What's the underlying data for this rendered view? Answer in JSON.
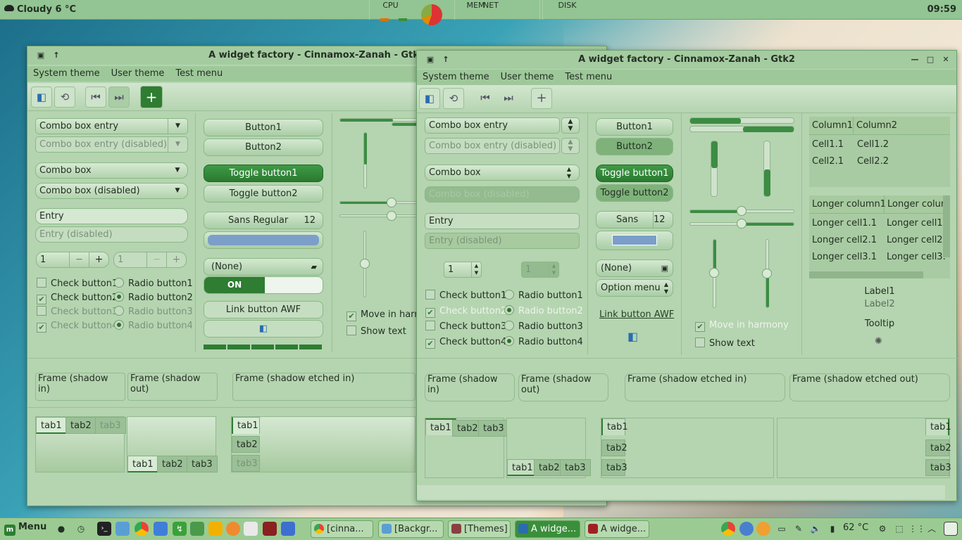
{
  "topbar": {
    "weather": "Cloudy 6 °C",
    "monitors": [
      "CPU",
      "MEM",
      "NET",
      "DISK"
    ],
    "clock": "09:59"
  },
  "gtk3": {
    "title": "A widget factory - Cinnamox-Zanah - Gtk3",
    "menus": [
      "System theme",
      "User theme",
      "Test menu"
    ],
    "combo_entry": "Combo box entry",
    "combo_entry_dis": "Combo box entry (disabled)",
    "combo": "Combo box",
    "combo_dis": "Combo box (disabled)",
    "entry": "Entry",
    "entry_dis": "Entry (disabled)",
    "spin1": "1",
    "spin2": "1",
    "checks": [
      "Check button1",
      "Check button2",
      "Check button3",
      "Check button4"
    ],
    "radios": [
      "Radio button1",
      "Radio button2",
      "Radio button3",
      "Radio button4"
    ],
    "button1": "Button1",
    "button2": "Button2",
    "toggle1": "Toggle button1",
    "toggle2": "Toggle button2",
    "font": "Sans Regular",
    "font_size": "12",
    "none": "(None)",
    "switch": "ON",
    "link": "Link button AWF",
    "harmony": "Move in harm",
    "showtext": "Show text",
    "frames": [
      "Frame (shadow in)",
      "Frame (shadow out)",
      "Frame (shadow etched in)"
    ],
    "tabs": [
      "tab1",
      "tab2",
      "tab3"
    ]
  },
  "gtk2": {
    "title": "A widget factory - Cinnamox-Zanah - Gtk2",
    "menus": [
      "System theme",
      "User theme",
      "Test menu"
    ],
    "combo_entry": "Combo box entry",
    "combo_entry_dis": "Combo box entry (disabled)",
    "combo": "Combo box",
    "combo_dis": "Combo box (disabled)",
    "entry": "Entry",
    "entry_dis": "Entry (disabled)",
    "spin1": "1",
    "spin2": "1",
    "checks": [
      "Check button1",
      "Check button2",
      "Check button3",
      "Check button4"
    ],
    "radios": [
      "Radio button1",
      "Radio button2",
      "Radio button3",
      "Radio button4"
    ],
    "button1": "Button1",
    "button2": "Button2",
    "toggle1": "Toggle button1",
    "toggle2": "Toggle button2",
    "font": "Sans",
    "font_size": "12",
    "none": "(None)",
    "option_menu": "Option menu",
    "link": "Link button AWF",
    "harmony": "Move in harmony",
    "showtext": "Show text",
    "tree1_cols": [
      "Column1",
      "Column2"
    ],
    "tree1_rows": [
      [
        "Cell1.1",
        "Cell1.2"
      ],
      [
        "Cell2.1",
        "Cell2.2"
      ]
    ],
    "tree2_cols": [
      "Longer column1",
      "Longer colun"
    ],
    "tree2_rows": [
      [
        "Longer cell1.1",
        "Longer cell1."
      ],
      [
        "Longer cell2.1",
        "Longer cell2."
      ],
      [
        "Longer cell3.1",
        "Longer cell3."
      ]
    ],
    "label1": "Label1",
    "label2": "Label2",
    "tooltip": "Tooltip",
    "frames": [
      "Frame (shadow in)",
      "Frame (shadow out)",
      "Frame (shadow etched in)",
      "Frame (shadow etched out)"
    ],
    "tabs": [
      "tab1",
      "tab2",
      "tab3"
    ]
  },
  "panel": {
    "menu": "Menu",
    "tasks": [
      "[cinna...",
      "[Backgr...",
      "[Themes]",
      "A widge...",
      "A widge..."
    ],
    "temp": "62 °C"
  }
}
